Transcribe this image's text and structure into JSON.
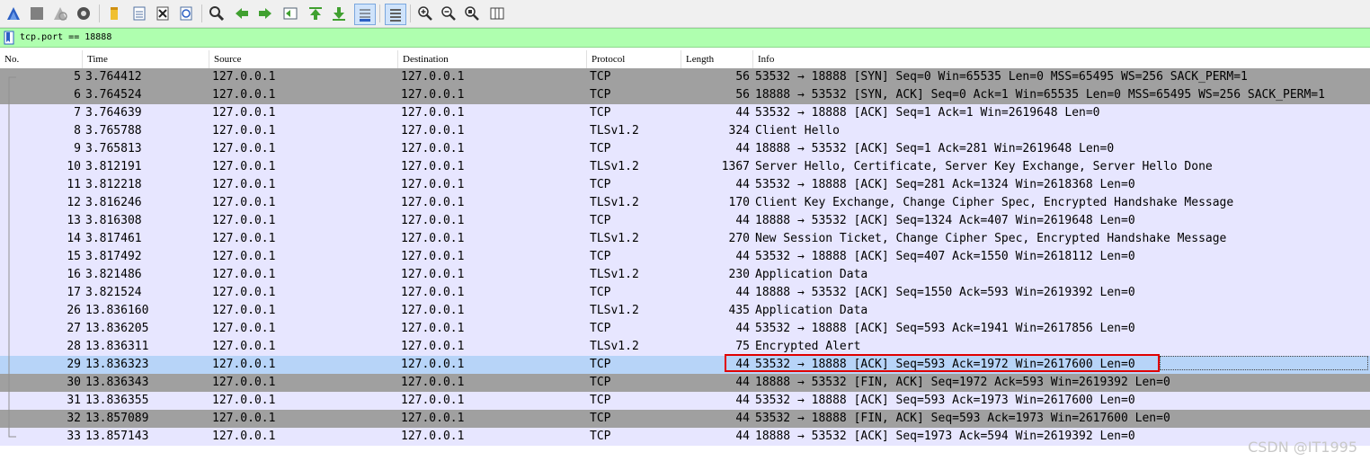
{
  "toolbar": {
    "buttons": [
      {
        "name": "start-capture-icon"
      },
      {
        "name": "stop-capture-icon"
      },
      {
        "name": "restart-capture-icon"
      },
      {
        "name": "capture-options-icon"
      },
      {
        "name": "open-file-icon"
      },
      {
        "name": "save-file-icon"
      },
      {
        "name": "close-file-icon"
      },
      {
        "name": "reload-file-icon"
      },
      {
        "name": "find-packet-icon"
      },
      {
        "name": "go-back-icon"
      },
      {
        "name": "go-forward-icon"
      },
      {
        "name": "go-to-packet-icon"
      },
      {
        "name": "go-first-packet-icon"
      },
      {
        "name": "go-last-packet-icon"
      },
      {
        "name": "autoscroll-icon"
      },
      {
        "name": "colorize-icon"
      },
      {
        "name": "zoom-in-icon"
      },
      {
        "name": "zoom-out-icon"
      },
      {
        "name": "zoom-normal-icon"
      },
      {
        "name": "resize-columns-icon"
      }
    ]
  },
  "filter": {
    "value": "tcp.port == 18888"
  },
  "columns": [
    "No.",
    "Time",
    "Source",
    "Destination",
    "Protocol",
    "Length",
    "Info"
  ],
  "packets": [
    {
      "no": "5",
      "time": "3.764412",
      "src": "127.0.0.1",
      "dst": "127.0.0.1",
      "proto": "TCP",
      "len": "56",
      "info": "53532 → 18888 [SYN] Seq=0 Win=65535 Len=0 MSS=65495 WS=256 SACK_PERM=1",
      "style": "gray"
    },
    {
      "no": "6",
      "time": "3.764524",
      "src": "127.0.0.1",
      "dst": "127.0.0.1",
      "proto": "TCP",
      "len": "56",
      "info": "18888 → 53532 [SYN, ACK] Seq=0 Ack=1 Win=65535 Len=0 MSS=65495 WS=256 SACK_PERM=1",
      "style": "gray"
    },
    {
      "no": "7",
      "time": "3.764639",
      "src": "127.0.0.1",
      "dst": "127.0.0.1",
      "proto": "TCP",
      "len": "44",
      "info": "53532 → 18888 [ACK] Seq=1 Ack=1 Win=2619648 Len=0",
      "style": "normal"
    },
    {
      "no": "8",
      "time": "3.765788",
      "src": "127.0.0.1",
      "dst": "127.0.0.1",
      "proto": "TLSv1.2",
      "len": "324",
      "info": "Client Hello",
      "style": "normal"
    },
    {
      "no": "9",
      "time": "3.765813",
      "src": "127.0.0.1",
      "dst": "127.0.0.1",
      "proto": "TCP",
      "len": "44",
      "info": "18888 → 53532 [ACK] Seq=1 Ack=281 Win=2619648 Len=0",
      "style": "normal"
    },
    {
      "no": "10",
      "time": "3.812191",
      "src": "127.0.0.1",
      "dst": "127.0.0.1",
      "proto": "TLSv1.2",
      "len": "1367",
      "info": "Server Hello, Certificate, Server Key Exchange, Server Hello Done",
      "style": "normal"
    },
    {
      "no": "11",
      "time": "3.812218",
      "src": "127.0.0.1",
      "dst": "127.0.0.1",
      "proto": "TCP",
      "len": "44",
      "info": "53532 → 18888 [ACK] Seq=281 Ack=1324 Win=2618368 Len=0",
      "style": "normal"
    },
    {
      "no": "12",
      "time": "3.816246",
      "src": "127.0.0.1",
      "dst": "127.0.0.1",
      "proto": "TLSv1.2",
      "len": "170",
      "info": "Client Key Exchange, Change Cipher Spec, Encrypted Handshake Message",
      "style": "normal"
    },
    {
      "no": "13",
      "time": "3.816308",
      "src": "127.0.0.1",
      "dst": "127.0.0.1",
      "proto": "TCP",
      "len": "44",
      "info": "18888 → 53532 [ACK] Seq=1324 Ack=407 Win=2619648 Len=0",
      "style": "normal"
    },
    {
      "no": "14",
      "time": "3.817461",
      "src": "127.0.0.1",
      "dst": "127.0.0.1",
      "proto": "TLSv1.2",
      "len": "270",
      "info": "New Session Ticket, Change Cipher Spec, Encrypted Handshake Message",
      "style": "normal"
    },
    {
      "no": "15",
      "time": "3.817492",
      "src": "127.0.0.1",
      "dst": "127.0.0.1",
      "proto": "TCP",
      "len": "44",
      "info": "53532 → 18888 [ACK] Seq=407 Ack=1550 Win=2618112 Len=0",
      "style": "normal"
    },
    {
      "no": "16",
      "time": "3.821486",
      "src": "127.0.0.1",
      "dst": "127.0.0.1",
      "proto": "TLSv1.2",
      "len": "230",
      "info": "Application Data",
      "style": "normal"
    },
    {
      "no": "17",
      "time": "3.821524",
      "src": "127.0.0.1",
      "dst": "127.0.0.1",
      "proto": "TCP",
      "len": "44",
      "info": "18888 → 53532 [ACK] Seq=1550 Ack=593 Win=2619392 Len=0",
      "style": "normal"
    },
    {
      "no": "26",
      "time": "13.836160",
      "src": "127.0.0.1",
      "dst": "127.0.0.1",
      "proto": "TLSv1.2",
      "len": "435",
      "info": "Application Data",
      "style": "normal"
    },
    {
      "no": "27",
      "time": "13.836205",
      "src": "127.0.0.1",
      "dst": "127.0.0.1",
      "proto": "TCP",
      "len": "44",
      "info": "53532 → 18888 [ACK] Seq=593 Ack=1941 Win=2617856 Len=0",
      "style": "normal"
    },
    {
      "no": "28",
      "time": "13.836311",
      "src": "127.0.0.1",
      "dst": "127.0.0.1",
      "proto": "TLSv1.2",
      "len": "75",
      "info": "Encrypted Alert",
      "style": "normal"
    },
    {
      "no": "29",
      "time": "13.836323",
      "src": "127.0.0.1",
      "dst": "127.0.0.1",
      "proto": "TCP",
      "len": "44",
      "info": "53532 → 18888 [ACK] Seq=593 Ack=1972 Win=2617600 Len=0",
      "style": "sel"
    },
    {
      "no": "30",
      "time": "13.836343",
      "src": "127.0.0.1",
      "dst": "127.0.0.1",
      "proto": "TCP",
      "len": "44",
      "info": "18888 → 53532 [FIN, ACK] Seq=1972 Ack=593 Win=2619392 Len=0",
      "style": "gray"
    },
    {
      "no": "31",
      "time": "13.836355",
      "src": "127.0.0.1",
      "dst": "127.0.0.1",
      "proto": "TCP",
      "len": "44",
      "info": "53532 → 18888 [ACK] Seq=593 Ack=1973 Win=2617600 Len=0",
      "style": "normal"
    },
    {
      "no": "32",
      "time": "13.857089",
      "src": "127.0.0.1",
      "dst": "127.0.0.1",
      "proto": "TCP",
      "len": "44",
      "info": "53532 → 18888 [FIN, ACK] Seq=593 Ack=1973 Win=2617600 Len=0",
      "style": "gray"
    },
    {
      "no": "33",
      "time": "13.857143",
      "src": "127.0.0.1",
      "dst": "127.0.0.1",
      "proto": "TCP",
      "len": "44",
      "info": "18888 → 53532 [ACK] Seq=1973 Ack=594 Win=2619392 Len=0",
      "style": "normal"
    }
  ],
  "colors": {
    "normal_row": "#e7e6ff",
    "gray_row": "#a0a0a0",
    "selected_row": "#b7d4f8",
    "filter_bg": "#afffaf",
    "highlight_border": "#e00000"
  },
  "watermark": "CSDN @IT1995"
}
